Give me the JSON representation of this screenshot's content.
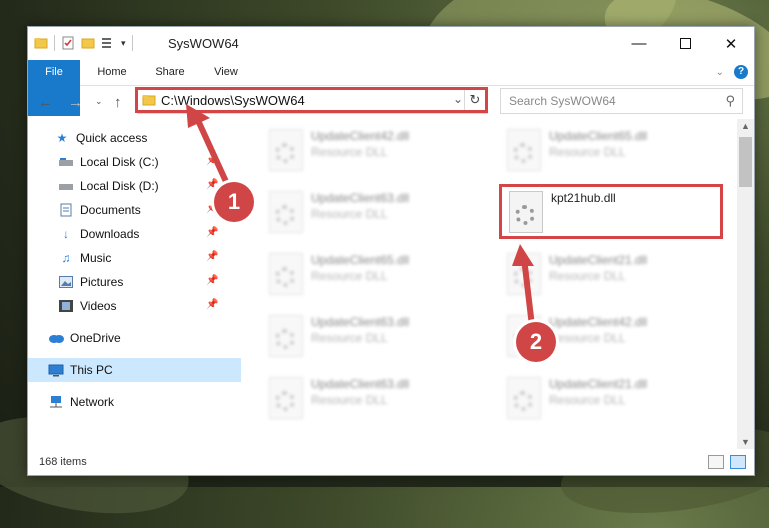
{
  "window": {
    "title": "SysWOW64",
    "ribbon_tabs": [
      "File",
      "Home",
      "Share",
      "View"
    ]
  },
  "addressbar": {
    "path": "C:\\Windows\\SysWOW64",
    "search_placeholder": "Search SysWOW64"
  },
  "sidebar": {
    "items": [
      {
        "label": "Quick access",
        "icon": "star-icon",
        "pinned": false
      },
      {
        "label": "Local Disk (C:)",
        "icon": "drive-icon",
        "pinned": true
      },
      {
        "label": "Local Disk (D:)",
        "icon": "drive-icon",
        "pinned": true
      },
      {
        "label": "Documents",
        "icon": "documents-icon",
        "pinned": true
      },
      {
        "label": "Downloads",
        "icon": "download-icon",
        "pinned": true
      },
      {
        "label": "Music",
        "icon": "music-icon",
        "pinned": true
      },
      {
        "label": "Pictures",
        "icon": "pictures-icon",
        "pinned": true
      },
      {
        "label": "Videos",
        "icon": "videos-icon",
        "pinned": true
      },
      {
        "label": "OneDrive",
        "icon": "cloud-icon",
        "pinned": false
      },
      {
        "label": "This PC",
        "icon": "computer-icon",
        "pinned": false,
        "selected": true
      },
      {
        "label": "Network",
        "icon": "network-icon",
        "pinned": false
      }
    ]
  },
  "files": [
    {
      "name": "UpdateClient42.dll",
      "type": "Resource DLL",
      "blurred": true
    },
    {
      "name": "UpdateClient65.dll",
      "type": "Resource DLL",
      "blurred": true
    },
    {
      "name": "UpdateClient63.dll",
      "type": "Resource DLL",
      "blurred": true
    },
    {
      "name": "kpt21hub.dll",
      "type": "",
      "blurred": false
    },
    {
      "name": "UpdateClient65.dll",
      "type": "Resource DLL",
      "blurred": true
    },
    {
      "name": "UpdateClient21.dll",
      "type": "Resource DLL",
      "blurred": true
    },
    {
      "name": "UpdateClient63.dll",
      "type": "Resource DLL",
      "blurred": true
    },
    {
      "name": "UpdateClient42.dll",
      "type": "Resource DLL",
      "blurred": true
    },
    {
      "name": "UpdateClient63.dll",
      "type": "Resource DLL",
      "blurred": true
    },
    {
      "name": "UpdateClient21.dll",
      "type": "Resource DLL",
      "blurred": true
    }
  ],
  "status": {
    "item_count": "168 items"
  },
  "annotations": {
    "callout1": "1",
    "callout2": "2",
    "color": "#d04545"
  }
}
